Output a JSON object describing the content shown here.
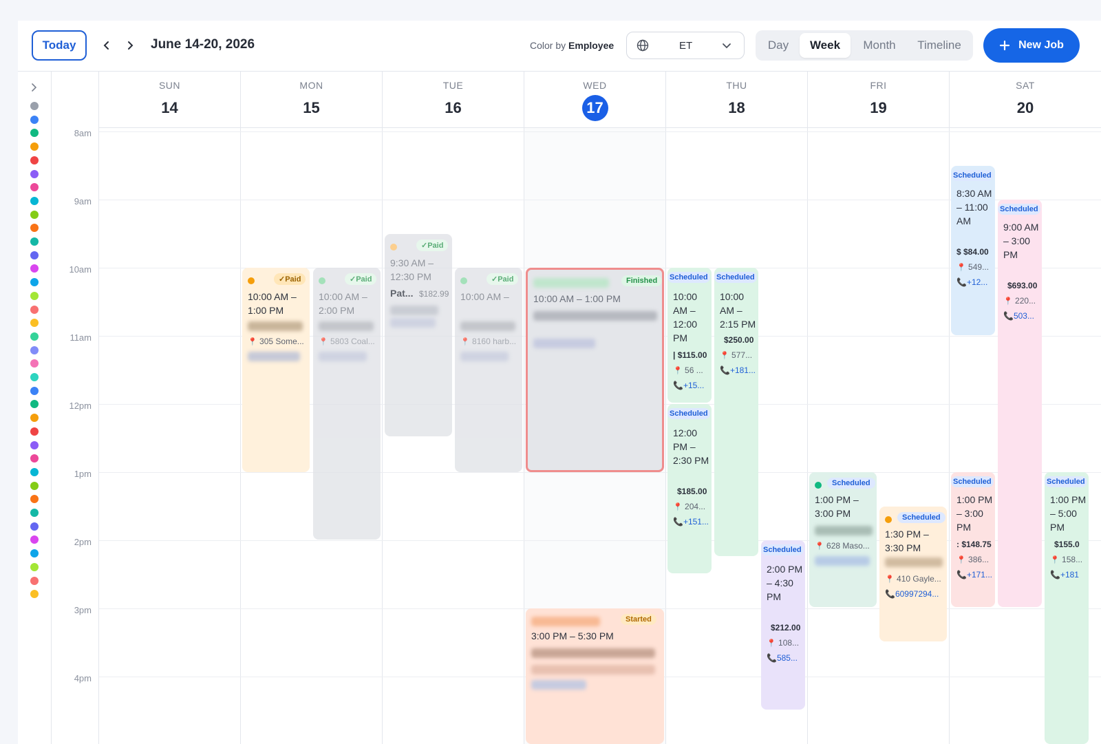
{
  "toolbar": {
    "today_label": "Today",
    "date_range": "June 14-20, 2026",
    "color_by_label": "Color by",
    "color_by_value": "Employee",
    "timezone": "ET",
    "views": [
      "Day",
      "Week",
      "Month",
      "Timeline"
    ],
    "active_view": "Week",
    "new_job_label": "New Job"
  },
  "days": [
    {
      "name": "SUN",
      "num": "14"
    },
    {
      "name": "MON",
      "num": "15"
    },
    {
      "name": "TUE",
      "num": "16"
    },
    {
      "name": "WED",
      "num": "17",
      "today": true
    },
    {
      "name": "THU",
      "num": "18"
    },
    {
      "name": "FRI",
      "num": "19"
    },
    {
      "name": "SAT",
      "num": "20"
    }
  ],
  "hours": [
    "8am",
    "9am",
    "10am",
    "11am",
    "12pm",
    "1pm",
    "2pm",
    "3pm",
    "4pm"
  ],
  "employee_dot_colors": [
    "#9aa0ab",
    "#3b82f6",
    "#10b981",
    "#f59e0b",
    "#ef4444",
    "#8b5cf6",
    "#ec4899",
    "#06b6d4",
    "#84cc16",
    "#f97316",
    "#14b8a6",
    "#6366f1",
    "#d946ef",
    "#0ea5e9",
    "#a3e635",
    "#f87171",
    "#fbbf24",
    "#34d399",
    "#818cf8",
    "#f472b6",
    "#2dd4bf",
    "#3b82f6",
    "#10b981",
    "#f59e0b",
    "#ef4444",
    "#8b5cf6",
    "#ec4899",
    "#06b6d4",
    "#84cc16",
    "#f97316",
    "#14b8a6",
    "#6366f1",
    "#d946ef",
    "#0ea5e9",
    "#a3e635",
    "#f87171",
    "#fbbf24"
  ],
  "events": {
    "mon1": {
      "badge": "✓Paid",
      "time": "10:00 AM – 1:00 PM",
      "addr": "305 Some..."
    },
    "mon2": {
      "badge": "✓Paid",
      "time": "10:00 AM – 2:00 PM",
      "addr": "5803 Coal..."
    },
    "tue1": {
      "badge": "✓Paid",
      "time": "9:30 AM – 12:30 PM",
      "title": "Pat...",
      "price": "$182.99"
    },
    "tue2": {
      "badge": "✓Paid",
      "time": "10:00 AM –",
      "addr": "8160 harb..."
    },
    "wed1": {
      "badge": "Finished",
      "time": "10:00 AM – 1:00 PM"
    },
    "wed2": {
      "badge": "Started",
      "time": "3:00 PM – 5:30 PM"
    },
    "thu1": {
      "badge": "Scheduled",
      "time": "10:00 AM – 12:00 PM",
      "price": "| $115.00",
      "addr": "56 ...",
      "phone": "+15..."
    },
    "thu2": {
      "badge": "Scheduled",
      "time": "10:00 AM – 2:15 PM",
      "price": "$250.00",
      "addr": "577...",
      "phone": "+181..."
    },
    "thu3": {
      "badge": "Scheduled",
      "time": "12:00 PM – 2:30 PM",
      "price": "$185.00",
      "addr": "204...",
      "phone": "+151..."
    },
    "thu4": {
      "badge": "Scheduled",
      "time": "2:00 PM – 4:30 PM",
      "price": "$212.00",
      "addr": "108...",
      "phone": "585..."
    },
    "fri1": {
      "badge": "Scheduled",
      "time": "1:00 PM – 3:00 PM",
      "addr": "628 Maso..."
    },
    "fri2": {
      "badge": "Scheduled",
      "time": "1:30 PM – 3:30 PM",
      "addr": "410 Gayle...",
      "phone": "60997294..."
    },
    "sat1": {
      "badge": "Scheduled",
      "time": "8:30 AM – 11:00 AM",
      "price": "$ $84.00",
      "addr": "549...",
      "phone": "+12..."
    },
    "sat2": {
      "badge": "Scheduled",
      "time": "9:00 AM – 3:00 PM",
      "price": "$693.00",
      "addr": "220...",
      "phone": "503..."
    },
    "sat3": {
      "badge": "Scheduled",
      "time": "1:00 PM – 3:00 PM",
      "price": ": $148.75",
      "addr": "386...",
      "phone": "+171..."
    },
    "sat4": {
      "badge": "Scheduled",
      "time": "1:00 PM – 5:00 PM",
      "price": "$155.0",
      "addr": "158...",
      "phone": "+181"
    }
  }
}
